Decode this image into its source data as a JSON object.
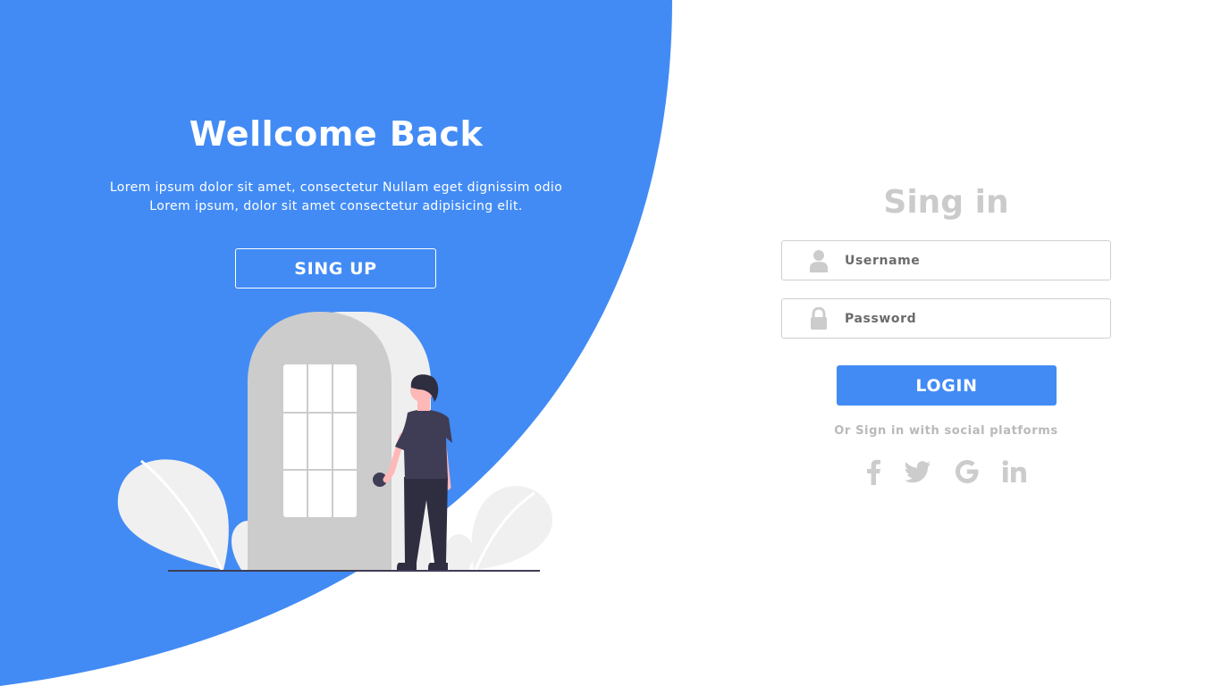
{
  "colors": {
    "accent": "#428bf5",
    "muted_text": "#cbcbcb",
    "field_border": "#cfcfcf",
    "illustration_gray": "#cccccc",
    "illustration_light": "#f0f0f0"
  },
  "welcome": {
    "title": "Wellcome Back",
    "description": "Lorem ipsum dolor sit amet, consectetur Nullam eget dignissim odio Lorem ipsum, dolor sit amet consectetur adipisicing elit.",
    "signup_label": "SING UP"
  },
  "signin": {
    "title": "Sing in",
    "username": {
      "placeholder": "Username",
      "value": "",
      "icon": "user-icon"
    },
    "password": {
      "placeholder": "Password",
      "value": "",
      "icon": "lock-icon"
    },
    "login_label": "LOGIN",
    "social_text": "Or Sign in with social platforms",
    "social": [
      {
        "name": "facebook",
        "icon": "facebook-icon"
      },
      {
        "name": "twitter",
        "icon": "twitter-icon"
      },
      {
        "name": "google",
        "icon": "google-icon"
      },
      {
        "name": "linkedin",
        "icon": "linkedin-icon"
      }
    ]
  }
}
